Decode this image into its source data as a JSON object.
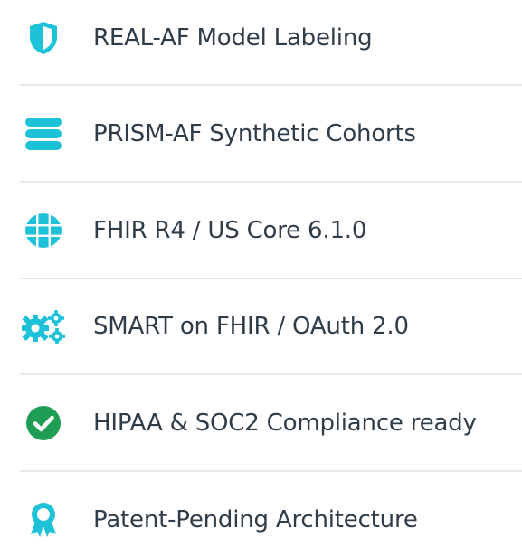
{
  "features": {
    "items": [
      {
        "label": "REAL-AF Model Labeling",
        "icon": "shield-icon"
      },
      {
        "label": "PRISM-AF Synthetic Cohorts",
        "icon": "database-icon"
      },
      {
        "label": "FHIR R4 / US Core 6.1.0",
        "icon": "globe-icon"
      },
      {
        "label": "SMART on FHIR / OAuth 2.0",
        "icon": "gears-icon"
      },
      {
        "label": "HIPAA & SOC2 Compliance ready",
        "icon": "check-circle-icon"
      },
      {
        "label": "Patent-Pending Architecture",
        "icon": "award-icon"
      }
    ]
  },
  "colors": {
    "icon_cyan": "#1ec2d8",
    "icon_green": "#1f9d55",
    "text": "#2f3d4a",
    "divider": "#e6e8ec"
  }
}
